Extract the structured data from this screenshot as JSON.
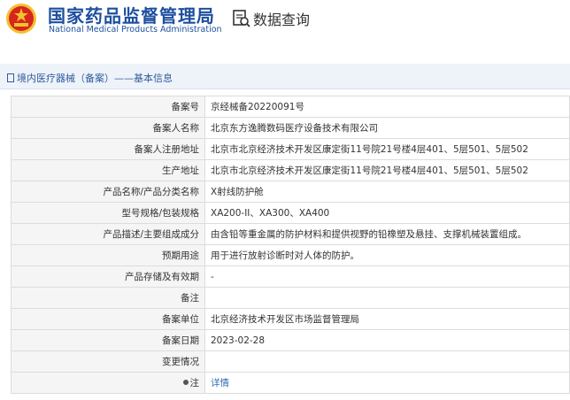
{
  "header": {
    "title_cn": "国家药品监督管理局",
    "title_en": "National Medical Products Administration",
    "query_title": "数据查询"
  },
  "breadcrumb": {
    "text": "境内医疗器械（备案）——基本信息"
  },
  "colors": {
    "brand_blue": "#1d4f9e",
    "emblem_red": "#d7261e",
    "emblem_gold": "#f2c12e",
    "link_blue": "#2f6fb5"
  },
  "rows": [
    {
      "label": "备案号",
      "value": "京经械备20220091号"
    },
    {
      "label": "备案人名称",
      "value": "北京东方逸腾数码医疗设备技术有限公司"
    },
    {
      "label": "备案人注册地址",
      "value": "北京市北京经济技术开发区康定街11号院21号楼4层401、5层501、5层502"
    },
    {
      "label": "生产地址",
      "value": "北京市北京经济技术开发区康定街11号院21号楼4层401、5层501、5层502"
    },
    {
      "label": "产品名称/产品分类名称",
      "value": "X射线防护舱"
    },
    {
      "label": "型号规格/包装规格",
      "value": "XA200-II、XA300、XA400"
    },
    {
      "label": "产品描述/主要组成成分",
      "value": "由含铅等重金属的防护材料和提供视野的铅橡塑及悬挂、支撑机械装置组成。"
    },
    {
      "label": "预期用途",
      "value": "用于进行放射诊断时对人体的防护。"
    },
    {
      "label": "产品存储及有效期",
      "value": "-"
    },
    {
      "label": "备注",
      "value": ""
    },
    {
      "label": "备案单位",
      "value": "北京经济技术开发区市场监督管理局"
    },
    {
      "label": "备案日期",
      "value": "2023-02-28"
    },
    {
      "label": "变更情况",
      "value": ""
    },
    {
      "label": "注",
      "value": "详情"
    }
  ],
  "icons": {
    "emblem": "national-emblem-icon",
    "query": "data-query-icon",
    "doc": "document-icon",
    "pin": "pin-icon"
  }
}
